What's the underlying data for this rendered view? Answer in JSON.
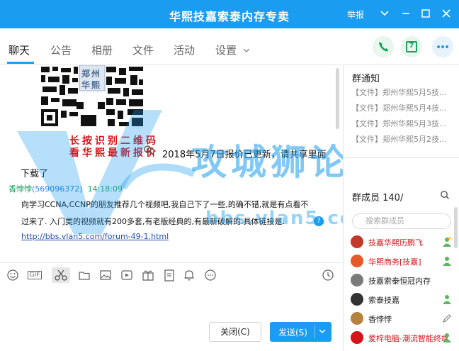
{
  "window": {
    "title": "华熙技嘉索泰内存专卖",
    "report_label": "举报"
  },
  "tabs": [
    {
      "label": "聊天"
    },
    {
      "label": "公告"
    },
    {
      "label": "相册"
    },
    {
      "label": "文件"
    },
    {
      "label": "活动"
    },
    {
      "label": "设置"
    }
  ],
  "actions": {
    "phone_icon": "phone-icon",
    "calendar_icon": "calendar-icon",
    "calendar_day": "7",
    "more_icon": "more-icon"
  },
  "qr": {
    "badge_line1": "郑州",
    "badge_line2": "华熙",
    "caption1": "长按识别二维码",
    "caption2": "看华熙最新报价"
  },
  "chat": {
    "msg1_line1": "2018年5月7日报价已更新，请共享里面",
    "msg1_line2": "下载了",
    "sender_name": "香悖悖",
    "sender_qq": "(569096372)",
    "sender_time": "14:18:09",
    "msg2_line1": "向学习CCNA,CCNP的朋友推荐几个视频吧,我自己下了一些,的确不错,就是有点看不",
    "msg2_line2": "过来了. 入门类的视频就有200多套,有老版经典的,有最新破解的.具体链接是:",
    "msg2_link": "http://bbs.vlan5.com/forum-49-1.html"
  },
  "watermark": {
    "text": "攻城狮论坛",
    "url": "bbs.vlan5.com"
  },
  "buttons": {
    "close": "关闭(C)",
    "send": "发送(S)"
  },
  "group": {
    "notice_title": "群通知",
    "notices": [
      "【文件】郑州华熙5月5技...",
      "【文件】郑州华熙5月4技...",
      "【文件】郑州华熙5月3技...",
      "【文件】郑州华熙5月2技..."
    ],
    "members_title": "群成员 140/",
    "search_placeholder": "搜索群成员",
    "members": [
      {
        "name": "技嘉华熙历鹏飞",
        "color": "#d4141a"
      },
      {
        "name": "华熙商务[技嘉]",
        "color": "#d4141a"
      },
      {
        "name": "技嘉索泰恒冠内存",
        "color": "#222222"
      },
      {
        "name": "索泰技嘉",
        "color": "#222222"
      },
      {
        "name": "香悖悖",
        "color": "#222222"
      },
      {
        "name": "爱梓电脑-潮流智能终端",
        "color": "#d4141a"
      }
    ]
  },
  "colors": {
    "accent": "#1a9cf0",
    "red": "#d4141a",
    "green": "#1aa260"
  }
}
